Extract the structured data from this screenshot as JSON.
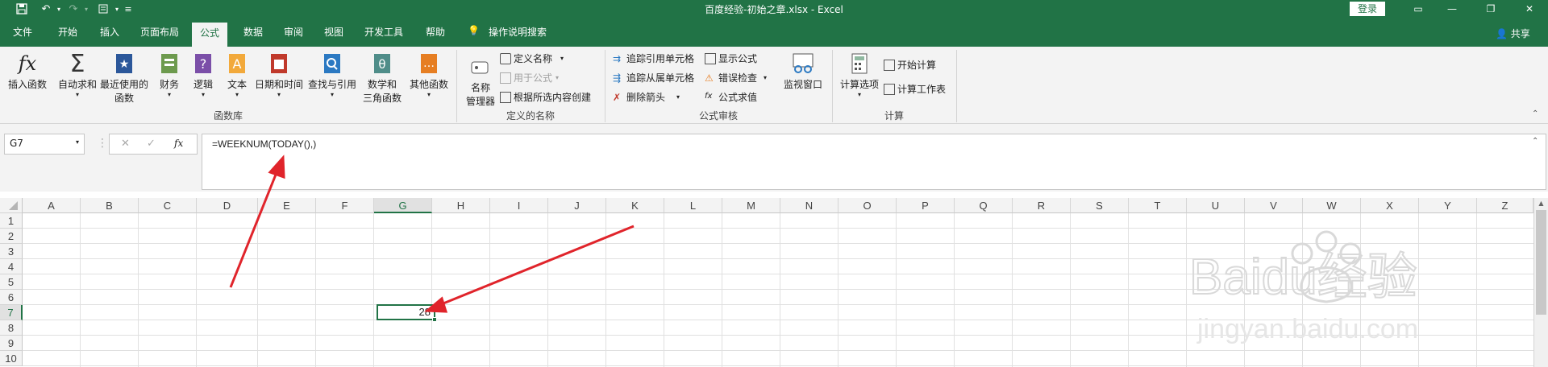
{
  "titlebar": {
    "title": "百度经验-初始之章.xlsx  -  Excel",
    "login": "登录",
    "colors": {
      "brand": "#217346"
    }
  },
  "tabs": [
    "文件",
    "开始",
    "插入",
    "页面布局",
    "公式",
    "数据",
    "审阅",
    "视图",
    "开发工具",
    "帮助",
    "操作说明搜索"
  ],
  "active_tab": "公式",
  "share": "共享",
  "ribbon": {
    "function_library": {
      "insert_function": "插入函数",
      "autosum": "自动求和",
      "recent_line1": "最近使用的",
      "recent_line2": "函数",
      "financial": "财务",
      "logical": "逻辑",
      "text": "文本",
      "datetime": "日期和时间",
      "lookup": "查找与引用",
      "math_line1": "数学和",
      "math_line2": "三角函数",
      "other": "其他函数",
      "group_label": "函数库"
    },
    "defined_names": {
      "name_manager_line1": "名称",
      "name_manager_line2": "管理器",
      "define_name": "定义名称",
      "use_in_formula": "用于公式",
      "create_from_selection": "根据所选内容创建",
      "group_label": "定义的名称"
    },
    "formula_auditing": {
      "trace_precedents": "追踪引用单元格",
      "trace_dependents": "追踪从属单元格",
      "remove_arrows": "删除箭头",
      "show_formulas": "显示公式",
      "error_checking": "错误检查",
      "evaluate_formula": "公式求值",
      "watch_window": "监视窗口",
      "group_label": "公式审核"
    },
    "calculation": {
      "calc_options": "计算选项",
      "calc_now": "开始计算",
      "calc_sheet": "计算工作表",
      "group_label": "计算"
    }
  },
  "formula_bar": {
    "name_box": "G7",
    "formula": "=WEEKNUM(TODAY(),)"
  },
  "grid": {
    "columns": [
      "A",
      "B",
      "C",
      "D",
      "E",
      "F",
      "G",
      "H",
      "I",
      "J",
      "K",
      "L",
      "M",
      "N",
      "O",
      "P",
      "Q",
      "R",
      "S",
      "T",
      "U",
      "V",
      "W",
      "X",
      "Y",
      "Z"
    ],
    "rows": [
      "1",
      "2",
      "3",
      "4",
      "5",
      "6",
      "7",
      "8",
      "9",
      "10"
    ],
    "selected_column": "G",
    "selected_row": "7",
    "active_cell_value": "28"
  },
  "watermark": {
    "text": "Baidu经验",
    "url": "jingyan.baidu.com"
  },
  "annotation_color": "#e0242b"
}
